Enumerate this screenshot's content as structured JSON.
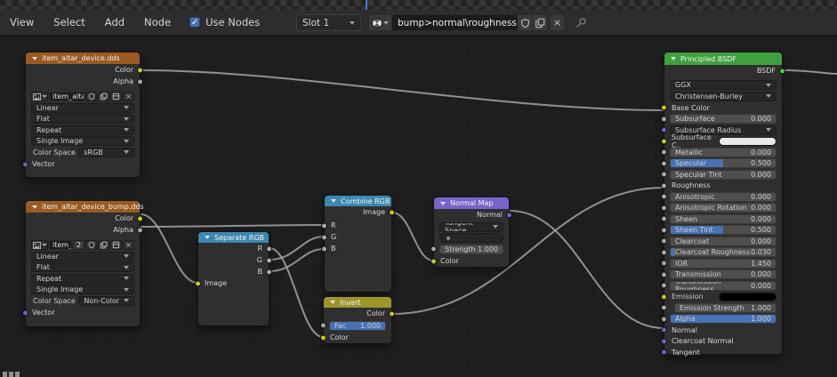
{
  "header": {
    "menus": [
      "View",
      "Select",
      "Add",
      "Node"
    ],
    "use_nodes": {
      "label": "Use Nodes",
      "checked": true
    },
    "slot": {
      "value": "Slot 1"
    },
    "material": {
      "name": "bump>normal\\roughness"
    },
    "icons": [
      "material-preview-sphere",
      "shield",
      "new-copy",
      "unlink-x",
      "pin"
    ]
  },
  "colors": {
    "accent_blue": "#4772b3",
    "header_texture": "#9a5a23",
    "header_converter": "#3d88b0",
    "header_color_op": "#9e942c",
    "header_vector": "#7a63cc",
    "header_shader": "#40a040",
    "socket_color": "#c7c729",
    "socket_float": "#a6a6a6",
    "socket_vector": "#6565c9",
    "socket_shader": "#43cf43"
  },
  "nodes": {
    "tex_color": {
      "title": "item_altar_device.dds",
      "outputs": [
        "Color",
        "Alpha"
      ],
      "image_name": "item_altar_devic..",
      "users_badge": "",
      "dropdowns": [
        "Linear",
        "Flat",
        "Repeat",
        "Single Image"
      ],
      "color_space_label": "Color Space",
      "color_space": "sRGB",
      "inputs": [
        "Vector"
      ]
    },
    "tex_bump": {
      "title": "item_altar_device_bump.dds",
      "outputs": [
        "Color",
        "Alpha"
      ],
      "image_name": "item_altar_d..",
      "users_badge": "2",
      "dropdowns": [
        "Linear",
        "Flat",
        "Repeat",
        "Single Image"
      ],
      "color_space_label": "Color Space",
      "color_space": "Non-Color",
      "inputs": [
        "Vector"
      ]
    },
    "separate_rgb": {
      "title": "Separate RGB",
      "outputs": [
        "R",
        "G",
        "B"
      ],
      "inputs": [
        "Image"
      ]
    },
    "combine_rgb": {
      "title": "Combine RGB",
      "outputs": [
        "Image"
      ],
      "inputs": [
        "R",
        "G",
        "B"
      ]
    },
    "invert": {
      "title": "Invert",
      "outputs": [
        "Color"
      ],
      "fac": {
        "label": "Fac",
        "value": "1.000"
      },
      "inputs": [
        "Color"
      ]
    },
    "normal_map": {
      "title": "Normal Map",
      "outputs": [
        "Normal"
      ],
      "space": "Tangent Space",
      "uv_map": "",
      "strength": {
        "label": "Strength",
        "value": "1.000"
      },
      "inputs": [
        "Color"
      ]
    },
    "principled": {
      "title": "Principled BSDF",
      "output": "BSDF",
      "distribution": "GGX",
      "subsurface_method": "Christensen-Burley",
      "rows": [
        {
          "type": "label",
          "label": "Base Color",
          "socket": "color"
        },
        {
          "type": "slider",
          "label": "Subsurface",
          "value": "0.000",
          "fill": 0,
          "socket": "float"
        },
        {
          "type": "dropdown",
          "label": "Subsurface Radius",
          "socket": "vector"
        },
        {
          "type": "color",
          "label": "Subsurface C..",
          "color": "#eaeaea",
          "socket": "color"
        },
        {
          "type": "slider",
          "label": "Metallic",
          "value": "0.000",
          "fill": 0,
          "socket": "float"
        },
        {
          "type": "slider",
          "label": "Specular",
          "value": "0.500",
          "fill": 0.5,
          "socket": "float"
        },
        {
          "type": "slider",
          "label": "Specular Tint",
          "value": "0.000",
          "fill": 0,
          "socket": "float"
        },
        {
          "type": "label",
          "label": "Roughness",
          "socket": "float"
        },
        {
          "type": "slider",
          "label": "Anisotropic",
          "value": "0.000",
          "fill": 0,
          "socket": "float"
        },
        {
          "type": "slider",
          "label": "Anisotropic Rotation",
          "value": "0.000",
          "fill": 0,
          "socket": "float"
        },
        {
          "type": "slider",
          "label": "Sheen",
          "value": "0.000",
          "fill": 0,
          "socket": "float"
        },
        {
          "type": "slider",
          "label": "Sheen Tint",
          "value": "0.500",
          "fill": 0.5,
          "socket": "float"
        },
        {
          "type": "slider",
          "label": "Clearcoat",
          "value": "0.000",
          "fill": 0,
          "socket": "float"
        },
        {
          "type": "slider",
          "label": "Clearcoat Roughness",
          "value": "0.030",
          "fill": 0.04,
          "socket": "float"
        },
        {
          "type": "slider",
          "label": "IOR",
          "value": "1.450",
          "fill": 0,
          "socket": "float"
        },
        {
          "type": "slider",
          "label": "Transmission",
          "value": "0.000",
          "fill": 0,
          "socket": "float"
        },
        {
          "type": "slider",
          "label": "Transmission Roughness",
          "value": "0.000",
          "fill": 0,
          "socket": "float"
        },
        {
          "type": "color",
          "label": "Emission",
          "color": "#000000",
          "socket": "color"
        },
        {
          "type": "slider",
          "label": "Emission Strength",
          "value": "1.000",
          "fill": 0,
          "socket": "float",
          "indent": true
        },
        {
          "type": "slider",
          "label": "Alpha",
          "value": "1.000",
          "fill": 1,
          "socket": "float"
        },
        {
          "type": "label",
          "label": "Normal",
          "socket": "vector"
        },
        {
          "type": "label",
          "label": "Clearcoat Normal",
          "socket": "vector"
        },
        {
          "type": "label",
          "label": "Tangent",
          "socket": "vector"
        }
      ]
    }
  },
  "connections": [
    {
      "from": "item_altar_device.dds.Color",
      "to": "Principled BSDF.Base Color"
    },
    {
      "from": "item_altar_device_bump.dds.Color",
      "to": "Separate RGB.Image"
    },
    {
      "from": "item_altar_device_bump.dds.Alpha",
      "to": "Combine RGB.R"
    },
    {
      "from": "Separate RGB.R",
      "to": "Invert.Color"
    },
    {
      "from": "Separate RGB.G",
      "to": "Combine RGB.G"
    },
    {
      "from": "Separate RGB.B",
      "to": "Combine RGB.B"
    },
    {
      "from": "Combine RGB.Image",
      "to": "Normal Map.Color"
    },
    {
      "from": "Invert.Color",
      "to": "Principled BSDF.Roughness"
    },
    {
      "from": "Normal Map.Normal",
      "to": "Principled BSDF.Normal"
    },
    {
      "from": "Principled BSDF.BSDF",
      "to": "offscreen-right"
    }
  ]
}
